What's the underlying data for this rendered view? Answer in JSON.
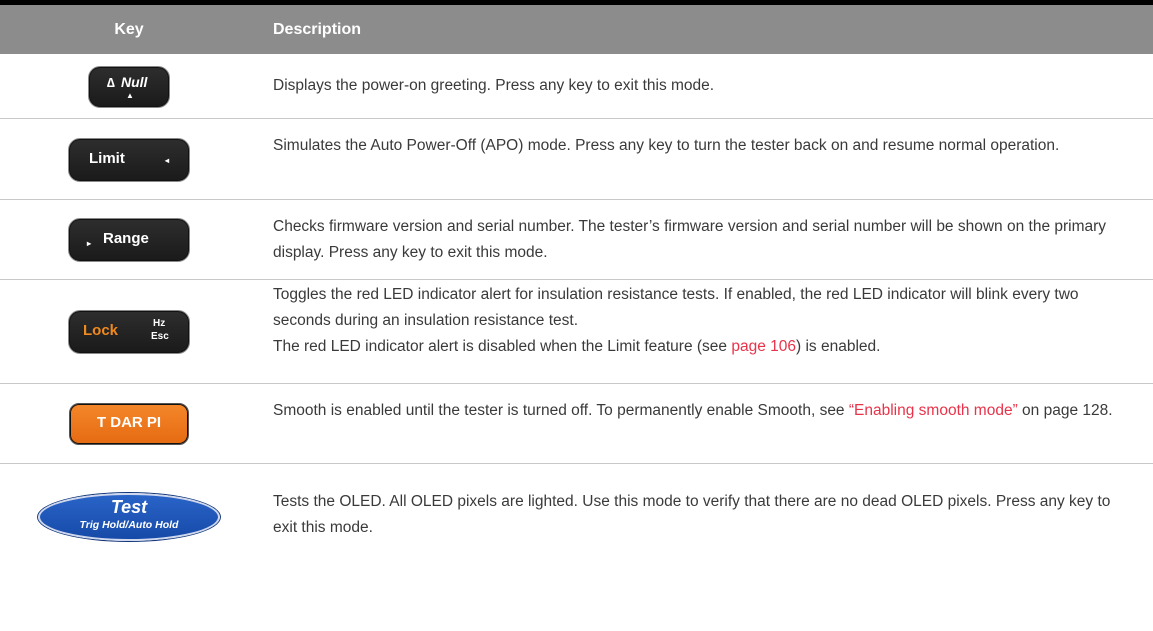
{
  "header": {
    "key": "Key",
    "description": "Description"
  },
  "rows": [
    {
      "key": {
        "symbol": "∆",
        "label": "Null",
        "arrow": "▲"
      },
      "desc": [
        "Displays the power-on greeting. Press any key to exit this mode."
      ]
    },
    {
      "key": {
        "label": "Limit",
        "arrow": "◂"
      },
      "desc": [
        "Simulates the Auto Power-Off (APO) mode. Press any key to turn the tester back on and resume normal operation."
      ]
    },
    {
      "key": {
        "label": "Range",
        "arrow": "▸"
      },
      "desc": [
        "Checks firmware version and serial number. The tester’s firmware version and serial number will be shown on the primary display. Press any key to exit this mode."
      ]
    },
    {
      "key": {
        "label": "Lock",
        "hz": "Hz",
        "esc": "Esc"
      },
      "desc": [
        "Toggles the red LED indicator alert for insulation resistance tests. If enabled, the red LED indicator will blink every two seconds during an insulation resistance test.",
        {
          "before": "The red LED indicator alert is disabled when the Limit feature (see ",
          "link": "page 106",
          "after": ") is enabled."
        }
      ]
    },
    {
      "key": {
        "label": "T DAR PI"
      },
      "desc": [
        {
          "before": "Smooth is enabled until the tester is turned off. To permanently enable Smooth, see ",
          "link": "“Enabling smooth mode”",
          "after": " on page 128."
        }
      ]
    },
    {
      "key": {
        "label": "Test",
        "sub": "Trig Hold/Auto Hold"
      },
      "desc": [
        "Tests the OLED. All OLED pixels are lighted. Use this mode to verify that there are no dead OLED pixels. Press any key to exit this mode."
      ]
    }
  ],
  "colors": {
    "header_bg": "#8c8c8c",
    "link": "#e8334a",
    "lock_text": "#f08a1e",
    "tdar_key": "#f07a1e",
    "test_key": "#1f57b8"
  }
}
